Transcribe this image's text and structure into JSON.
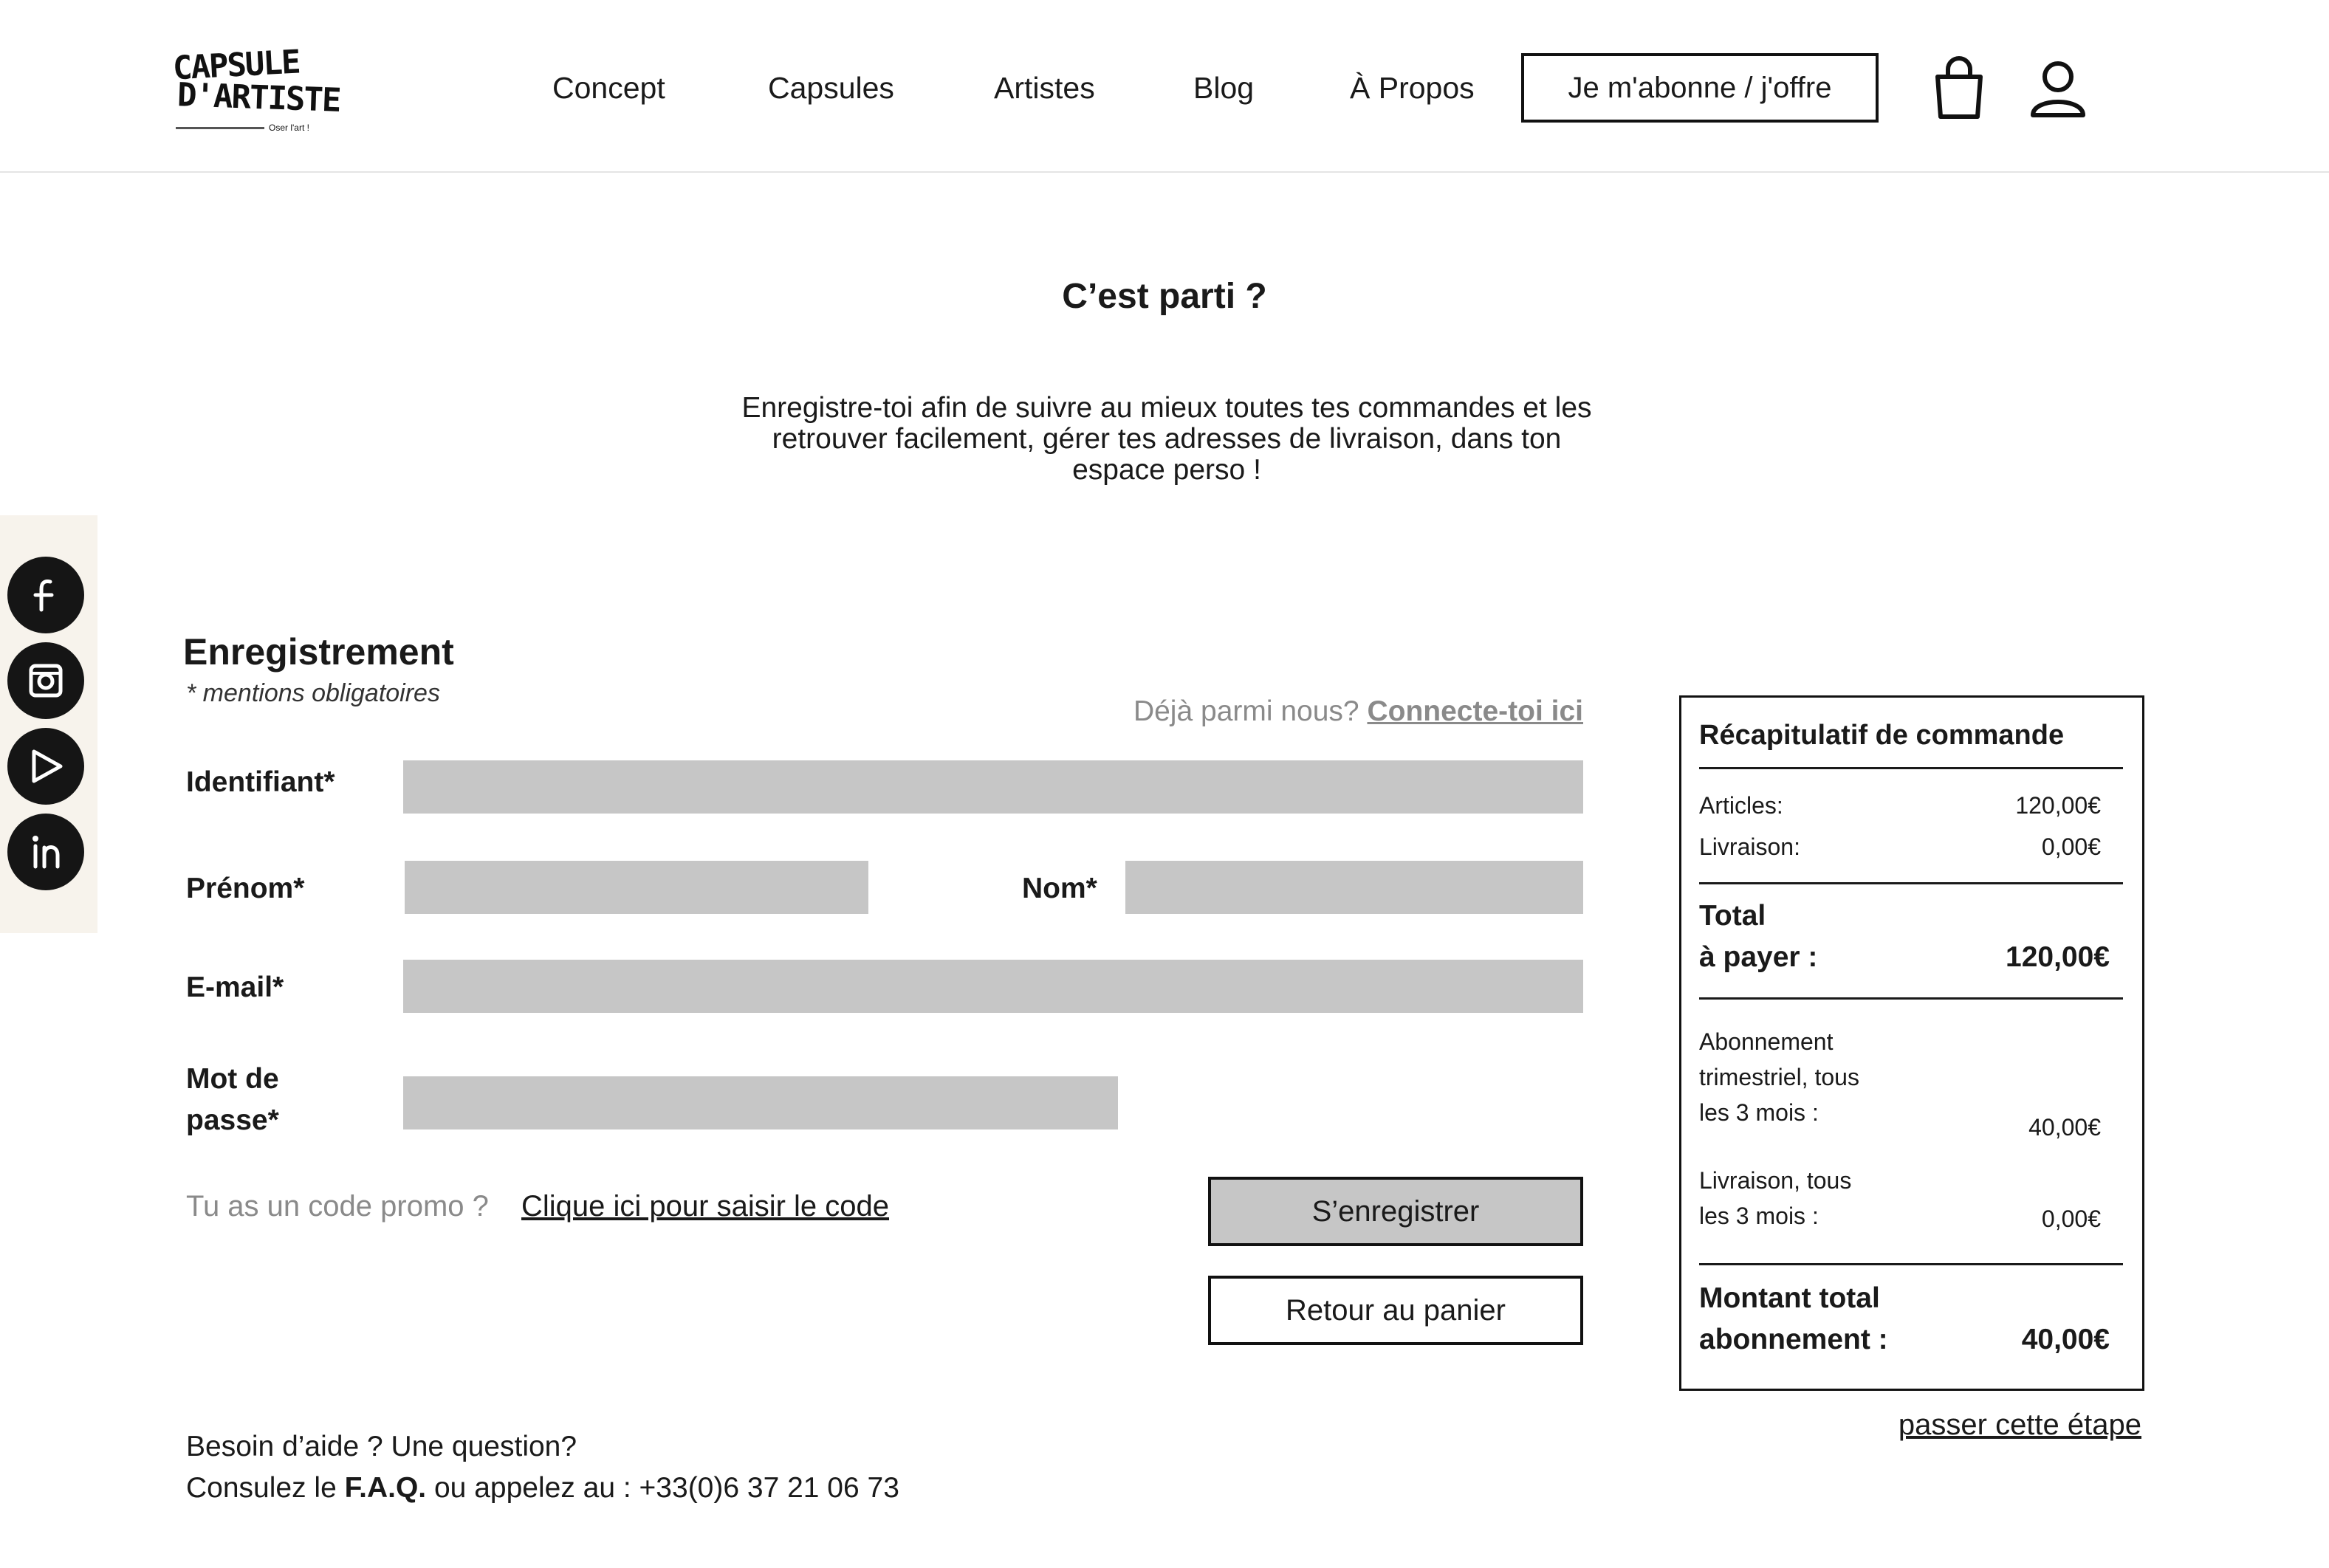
{
  "header": {
    "logo": {
      "line1": "CAPSULE",
      "line2": "D'ARTISTE",
      "tagline": "Oser l'art !"
    },
    "nav": [
      {
        "label": "Concept"
      },
      {
        "label": "Capsules"
      },
      {
        "label": "Artistes"
      },
      {
        "label": "Blog"
      },
      {
        "label": "À Propos"
      }
    ],
    "subscribe_label": "Je m'abonne / j'offre",
    "cart_icon": "shopping-bag-icon",
    "account_icon": "user-icon"
  },
  "social": [
    {
      "icon": "facebook-icon"
    },
    {
      "icon": "instagram-icon"
    },
    {
      "icon": "play-icon"
    },
    {
      "icon": "linkedin-icon"
    }
  ],
  "intro": {
    "title": "C’est parti ?",
    "text": "Enregistre-toi afin de suivre au mieux toutes tes commandes et les retrouver facilement, gérer tes adresses de livraison, dans ton espace perso !"
  },
  "form": {
    "title": "Enregistrement",
    "note": "* mentions obligatoires",
    "login_prompt": "Déjà parmi nous?",
    "login_link": "Connecte-toi ici",
    "fields": {
      "identifiant": {
        "label": "Identifiant*",
        "value": ""
      },
      "prenom": {
        "label": "Prénom*",
        "value": ""
      },
      "nom": {
        "label": "Nom*",
        "value": ""
      },
      "email": {
        "label": "E-mail*",
        "value": ""
      },
      "password": {
        "label_line1": "Mot de",
        "label_line2": "passe*",
        "value": ""
      }
    },
    "promo_prompt": "Tu as un code promo ?",
    "promo_link": "Clique ici pour saisir le code",
    "register_label": "S’enregistrer",
    "back_label": "Retour au panier"
  },
  "help": {
    "line1": "Besoin d’aide ? Une question?",
    "line2_prefix": "Consulez le",
    "faq": "F.A.Q.",
    "line2_suffix": "ou appelez au : +33(0)6 37 21 06 73"
  },
  "summary": {
    "title": "Récapitulatif de commande",
    "articles_label": "Articles:",
    "articles_value": "120,00€",
    "shipping_label": "Livraison:",
    "shipping_value": "0,00€",
    "total_label_line1": "Total",
    "total_label_line2": "à payer :",
    "total_value": "120,00€",
    "sub_label_line1": "Abonnement",
    "sub_label_line2": "trimestriel, tous",
    "sub_label_line3": "les 3 mois :",
    "sub_value": "40,00€",
    "sub_shipping_line1": "Livraison, tous",
    "sub_shipping_line2": "les 3 mois :",
    "sub_shipping_value": "0,00€",
    "sub_total_line1": "Montant total",
    "sub_total_line2": "abonnement :",
    "sub_total_value": "40,00€"
  },
  "skip_label": "passer cette étape"
}
